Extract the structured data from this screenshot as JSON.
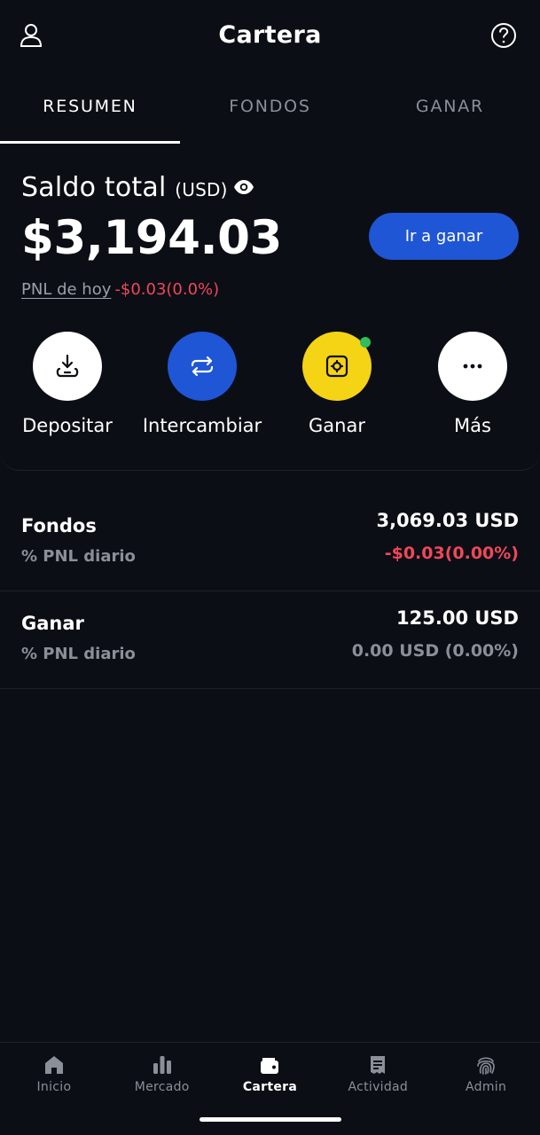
{
  "header": {
    "title": "Cartera"
  },
  "tabs": [
    {
      "label": "RESUMEN",
      "active": true
    },
    {
      "label": "FONDOS",
      "active": false
    },
    {
      "label": "GANAR",
      "active": false
    }
  ],
  "balance": {
    "label": "Saldo total",
    "currency": "(USD)",
    "value": "$3,194.03",
    "cta": "Ir a ganar",
    "pnl_label": "PNL de hoy",
    "pnl_value": "-$0.03(0.0%)"
  },
  "actions": [
    {
      "label": "Depositar",
      "icon": "download-icon",
      "bg": "#ffffff"
    },
    {
      "label": "Intercambiar",
      "icon": "swap-icon",
      "bg": "#1f56d6"
    },
    {
      "label": "Ganar",
      "icon": "vault-icon",
      "bg": "#f5d315"
    },
    {
      "label": "Más",
      "icon": "more-icon",
      "bg": "#ffffff"
    }
  ],
  "accounts": [
    {
      "name": "Fondos",
      "sub": "% PNL diario",
      "amount": "3,069.03 USD",
      "pnl": "-$0.03(0.00%)"
    },
    {
      "name": "Ganar",
      "sub": "% PNL diario",
      "amount": "125.00 USD",
      "pnl": "0.00 USD (0.00%)"
    }
  ],
  "nav": [
    {
      "label": "Inicio",
      "icon": "home-icon",
      "active": false
    },
    {
      "label": "Mercado",
      "icon": "bar-chart-icon",
      "active": false
    },
    {
      "label": "Cartera",
      "icon": "wallet-icon",
      "active": true
    },
    {
      "label": "Actividad",
      "icon": "receipt-icon",
      "active": false
    },
    {
      "label": "Admin",
      "icon": "fingerprint-icon",
      "active": false
    }
  ],
  "colors": {
    "background": "#0b0e14",
    "accent_blue": "#1f56d6",
    "accent_yellow": "#f5d315",
    "negative": "#f0475a",
    "online_dot": "#2fbf5a"
  }
}
